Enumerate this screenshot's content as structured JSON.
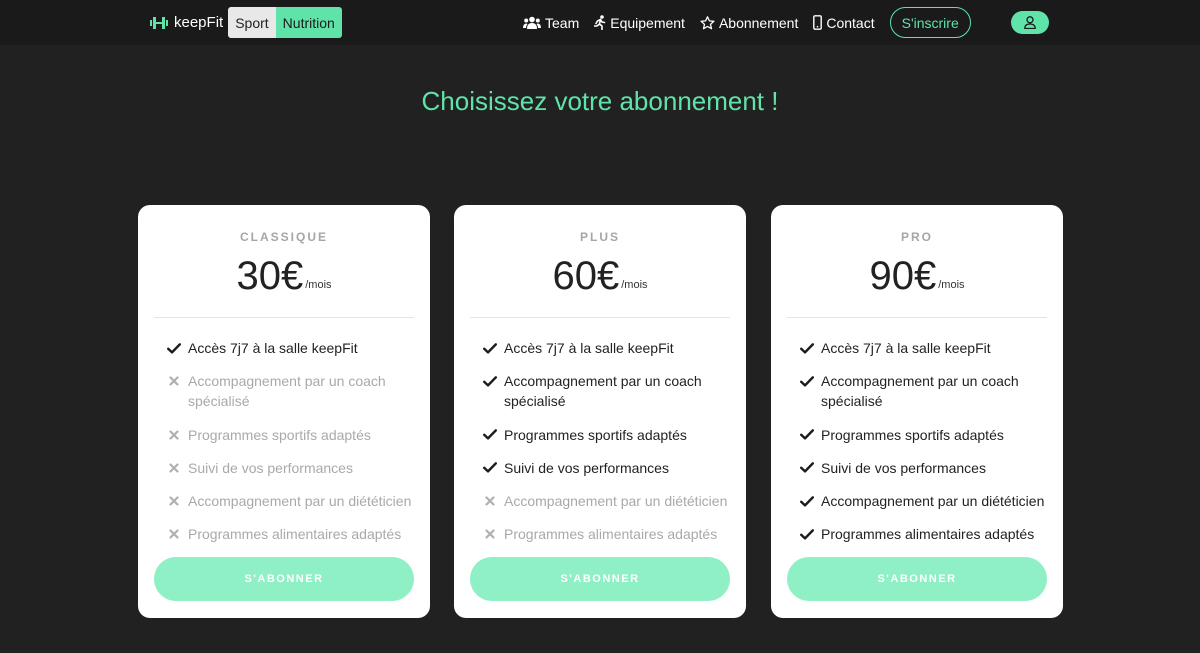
{
  "navbar": {
    "brand": "keepFit",
    "toggle": {
      "sport": "Sport",
      "nutrition": "Nutrition"
    },
    "links": [
      {
        "label": "Team",
        "icon": "users-icon"
      },
      {
        "label": "Equipement",
        "icon": "running-icon"
      },
      {
        "label": "Abonnement",
        "icon": "star-icon"
      },
      {
        "label": "Contact",
        "icon": "mobile-icon"
      }
    ],
    "signup": "S'inscrire",
    "user_icon": "user-icon"
  },
  "title": "Choisissez votre abonnement !",
  "colors": {
    "accent": "#5fe3a9",
    "button": "#8ef0c4",
    "background": "#212121"
  },
  "plans": [
    {
      "name": "CLASSIQUE",
      "price": "30€",
      "period": "/mois",
      "cta": "S'ABONNER",
      "features": [
        {
          "label": "Accès 7j7 à la salle keepFit",
          "included": true
        },
        {
          "label": "Accompagnement par un coach spécialisé",
          "included": false
        },
        {
          "label": "Programmes sportifs adaptés",
          "included": false
        },
        {
          "label": "Suivi de vos performances",
          "included": false
        },
        {
          "label": "Accompagnement par un diététicien",
          "included": false
        },
        {
          "label": "Programmes alimentaires adaptés",
          "included": false
        }
      ]
    },
    {
      "name": "PLUS",
      "price": "60€",
      "period": "/mois",
      "cta": "S'ABONNER",
      "features": [
        {
          "label": "Accès 7j7 à la salle keepFit",
          "included": true
        },
        {
          "label": "Accompagnement par un coach spécialisé",
          "included": true
        },
        {
          "label": "Programmes sportifs adaptés",
          "included": true
        },
        {
          "label": "Suivi de vos performances",
          "included": true
        },
        {
          "label": "Accompagnement par un diététicien",
          "included": false
        },
        {
          "label": "Programmes alimentaires adaptés",
          "included": false
        }
      ]
    },
    {
      "name": "PRO",
      "price": "90€",
      "period": "/mois",
      "cta": "S'ABONNER",
      "features": [
        {
          "label": "Accès 7j7 à la salle keepFit",
          "included": true
        },
        {
          "label": "Accompagnement par un coach spécialisé",
          "included": true
        },
        {
          "label": "Programmes sportifs adaptés",
          "included": true
        },
        {
          "label": "Suivi de vos performances",
          "included": true
        },
        {
          "label": "Accompagnement par un diététicien",
          "included": true
        },
        {
          "label": "Programmes alimentaires adaptés",
          "included": true
        }
      ]
    }
  ]
}
